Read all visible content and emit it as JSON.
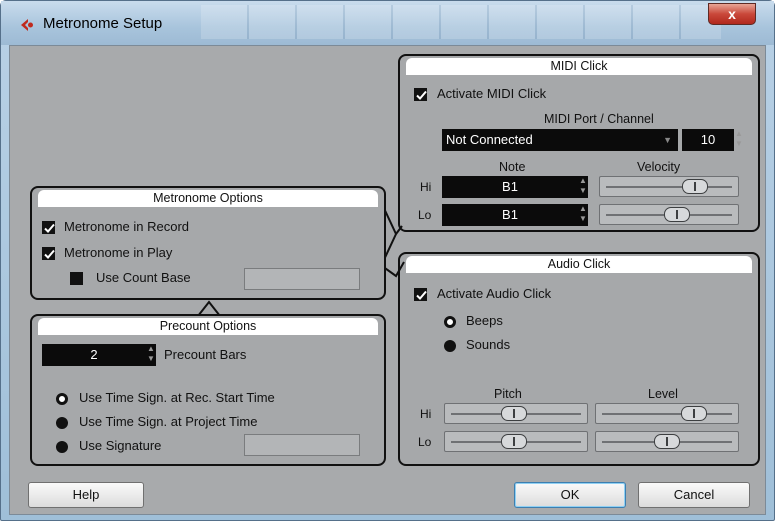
{
  "window": {
    "title": "Metronome Setup",
    "close_glyph": "x"
  },
  "midi_click": {
    "title": "MIDI Click",
    "activate_label": "Activate MIDI Click",
    "activate_checked": true,
    "port_label": "MIDI Port / Channel",
    "port_value": "Not Connected",
    "channel_value": "10",
    "note_header": "Note",
    "velocity_header": "Velocity",
    "hi_label": "Hi",
    "lo_label": "Lo",
    "hi_note": "B1",
    "lo_note": "B1",
    "hi_velocity_fraction": 0.76,
    "lo_velocity_fraction": 0.58
  },
  "metronome_options": {
    "title": "Metronome Options",
    "in_record_label": "Metronome in Record",
    "in_record_checked": true,
    "in_play_label": "Metronome in Play",
    "in_play_checked": true,
    "count_base_label": "Use Count Base",
    "count_base_checked": false
  },
  "precount_options": {
    "title": "Precount Options",
    "bars_value": "2",
    "bars_label": "Precount Bars",
    "radio_rec_start": "Use Time Sign. at Rec. Start Time",
    "radio_project": "Use Time Sign. at Project Time",
    "radio_signature": "Use Signature",
    "selected": "rec_start"
  },
  "audio_click": {
    "title": "Audio Click",
    "activate_label": "Activate Audio Click",
    "activate_checked": true,
    "beeps_label": "Beeps",
    "sounds_label": "Sounds",
    "selected_source": "beeps",
    "pitch_header": "Pitch",
    "level_header": "Level",
    "hi_label": "Hi",
    "lo_label": "Lo",
    "hi_pitch_fraction": 0.48,
    "lo_pitch_fraction": 0.48,
    "hi_level_fraction": 0.76,
    "lo_level_fraction": 0.5
  },
  "footer": {
    "help_label": "Help",
    "ok_label": "OK",
    "cancel_label": "Cancel"
  },
  "colors": {
    "panel_bg": "#a6a8aa",
    "panel_border": "#111111",
    "field_dark": "#0b0b0b",
    "title_close": "#c9483a"
  }
}
